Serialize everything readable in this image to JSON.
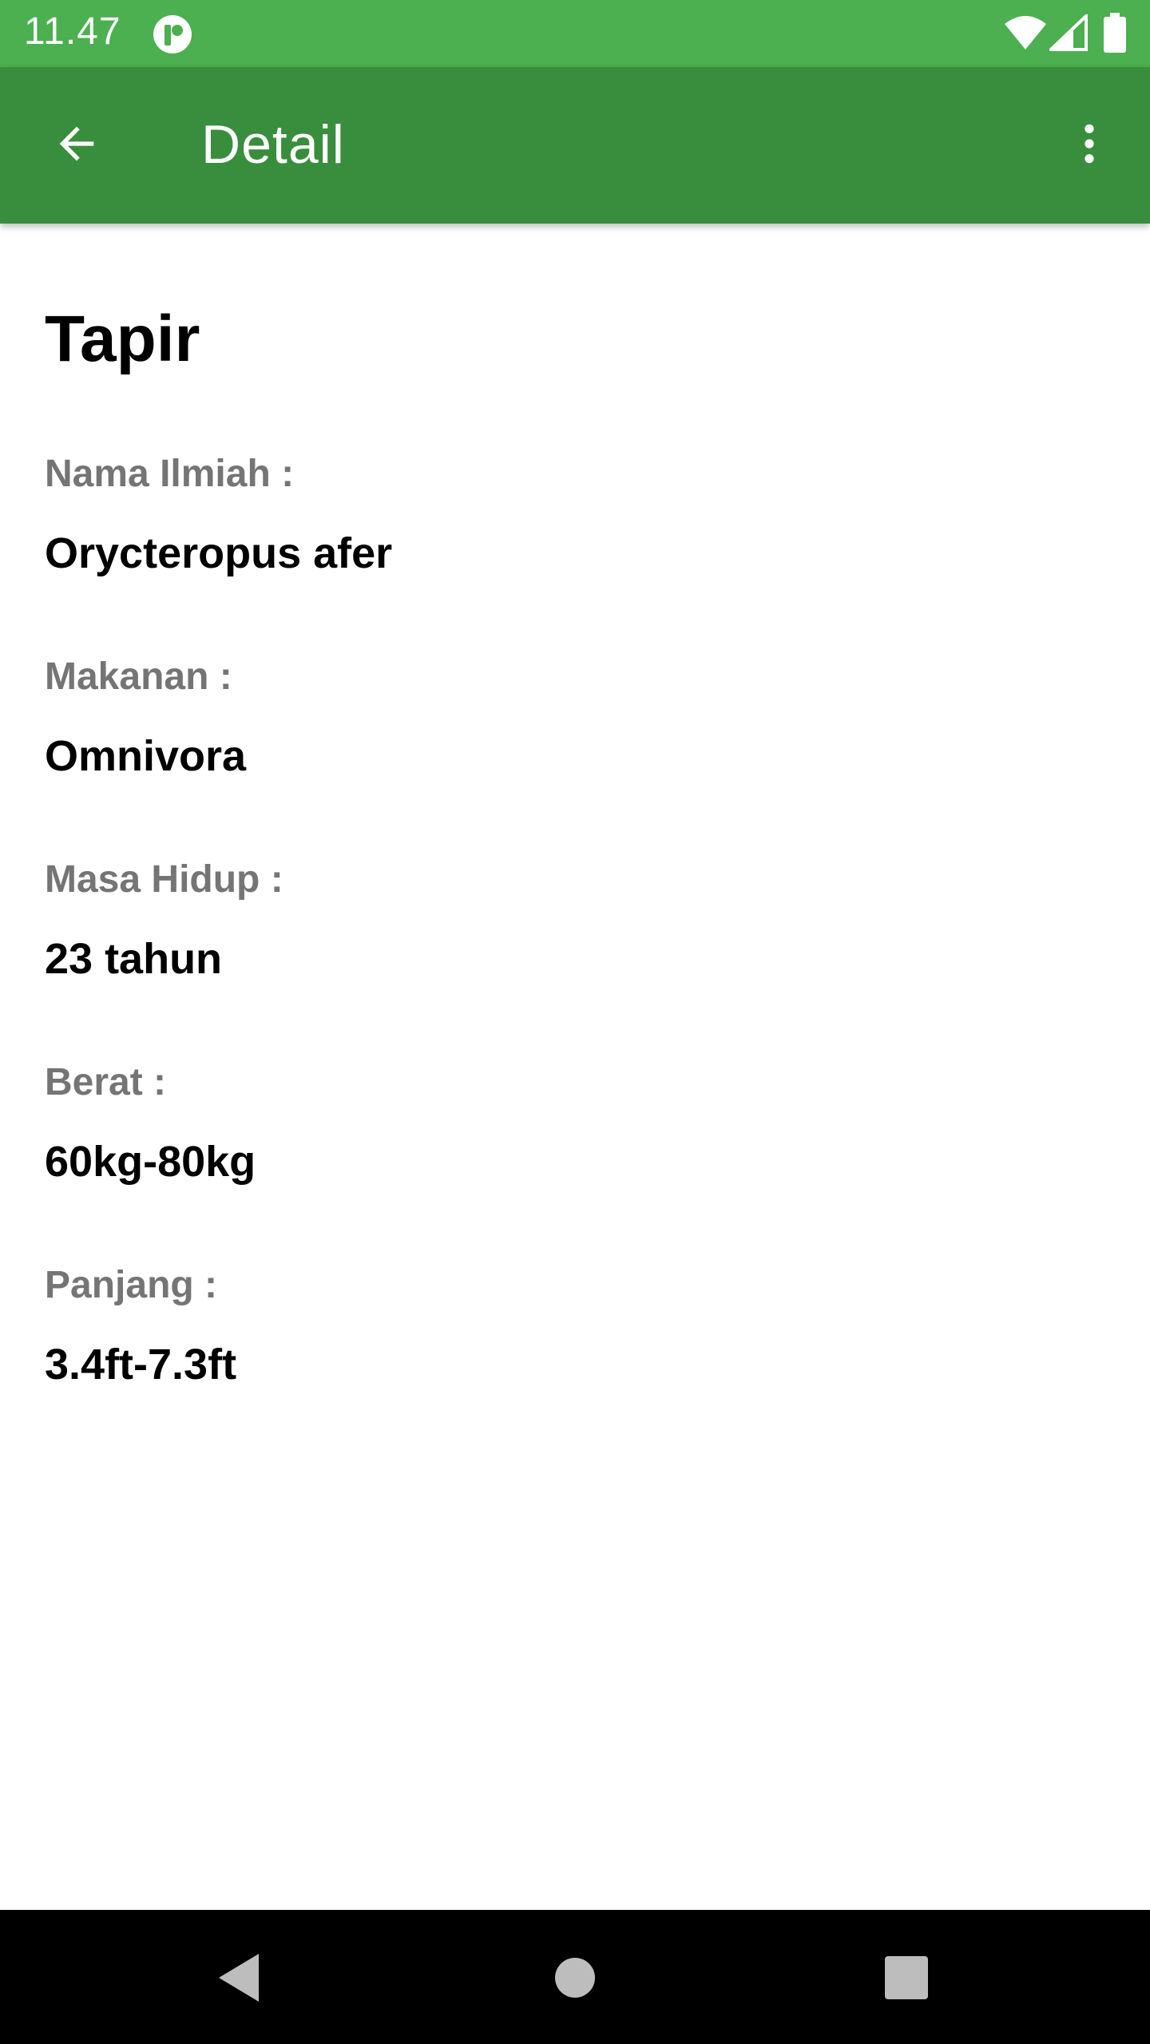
{
  "status_bar": {
    "time": "11.47",
    "icons": [
      "notification-icon",
      "wifi-icon",
      "signal-icon",
      "battery-icon"
    ]
  },
  "app_bar": {
    "title": "Detail",
    "back_icon": "arrow-back-icon",
    "menu_icon": "more-vert-icon"
  },
  "detail": {
    "name": "Tapir",
    "fields": [
      {
        "label": "Nama Ilmiah :",
        "value": "Orycteropus afer"
      },
      {
        "label": "Makanan :",
        "value": "Omnivora"
      },
      {
        "label": "Masa Hidup :",
        "value": "23 tahun"
      },
      {
        "label": "Berat :",
        "value": "60kg-80kg"
      },
      {
        "label": "Panjang :",
        "value": "3.4ft-7.3ft"
      }
    ]
  },
  "nav_bar": {
    "icons": [
      "nav-back-icon",
      "nav-home-icon",
      "nav-recents-icon"
    ]
  },
  "colors": {
    "status_bar": "#4caf50",
    "app_bar": "#388e3c",
    "label": "#757575",
    "value": "#000000"
  }
}
